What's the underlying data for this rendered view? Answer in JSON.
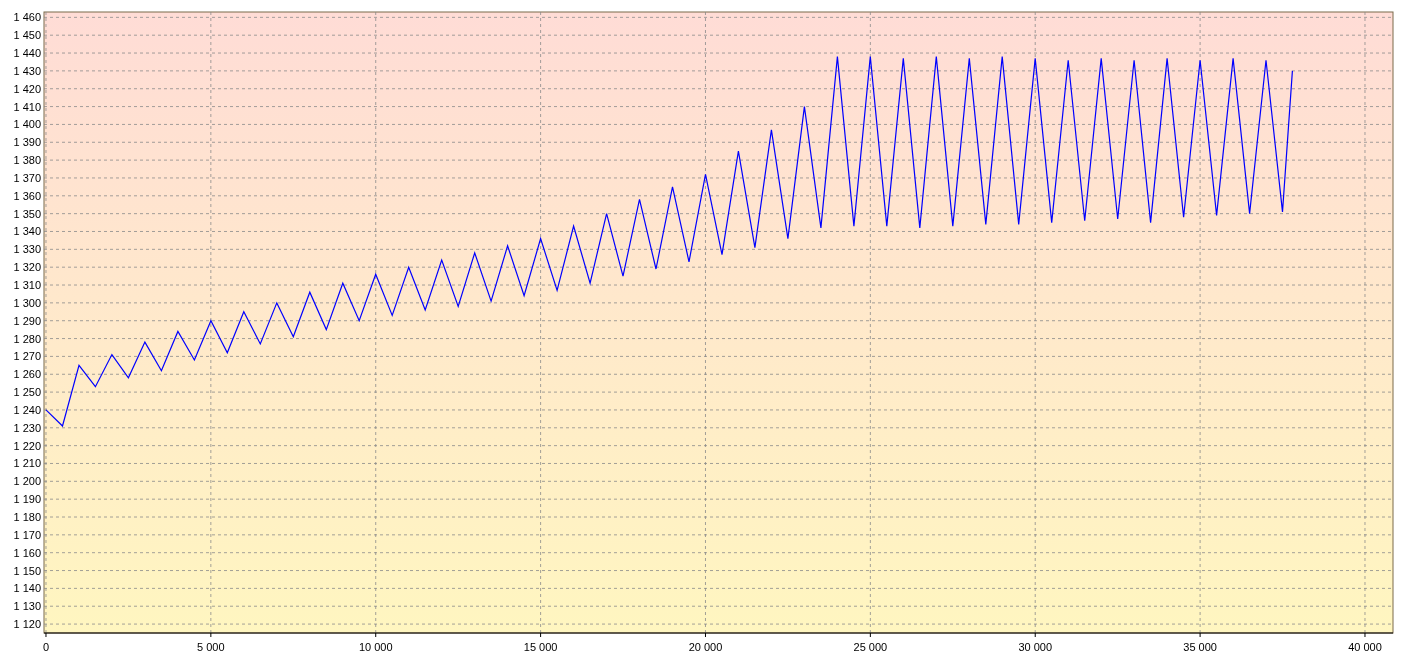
{
  "chart_data": {
    "type": "line",
    "grid": true,
    "xlim": [
      -60,
      40850
    ],
    "ylim": [
      1115,
      1463
    ],
    "xticks": [
      {
        "value": 0,
        "label": "0"
      },
      {
        "value": 5000,
        "label": "5 000"
      },
      {
        "value": 10000,
        "label": "10 000"
      },
      {
        "value": 15000,
        "label": "15 000"
      },
      {
        "value": 20000,
        "label": "20 000"
      },
      {
        "value": 25000,
        "label": "25 000"
      },
      {
        "value": 30000,
        "label": "30 000"
      },
      {
        "value": 35000,
        "label": "35 000"
      },
      {
        "value": 40000,
        "label": "40 000"
      }
    ],
    "yticks": [
      {
        "value": 1120,
        "label": "1 120"
      },
      {
        "value": 1130,
        "label": "1 130"
      },
      {
        "value": 1140,
        "label": "1 140"
      },
      {
        "value": 1150,
        "label": "1 150"
      },
      {
        "value": 1160,
        "label": "1 160"
      },
      {
        "value": 1170,
        "label": "1 170"
      },
      {
        "value": 1180,
        "label": "1 180"
      },
      {
        "value": 1190,
        "label": "1 190"
      },
      {
        "value": 1200,
        "label": "1 200"
      },
      {
        "value": 1210,
        "label": "1 210"
      },
      {
        "value": 1220,
        "label": "1 220"
      },
      {
        "value": 1230,
        "label": "1 230"
      },
      {
        "value": 1240,
        "label": "1 240"
      },
      {
        "value": 1250,
        "label": "1 250"
      },
      {
        "value": 1260,
        "label": "1 260"
      },
      {
        "value": 1270,
        "label": "1 270"
      },
      {
        "value": 1280,
        "label": "1 280"
      },
      {
        "value": 1290,
        "label": "1 290"
      },
      {
        "value": 1300,
        "label": "1 300"
      },
      {
        "value": 1310,
        "label": "1 310"
      },
      {
        "value": 1320,
        "label": "1 320"
      },
      {
        "value": 1330,
        "label": "1 330"
      },
      {
        "value": 1340,
        "label": "1 340"
      },
      {
        "value": 1350,
        "label": "1 350"
      },
      {
        "value": 1360,
        "label": "1 360"
      },
      {
        "value": 1370,
        "label": "1 370"
      },
      {
        "value": 1380,
        "label": "1 380"
      },
      {
        "value": 1390,
        "label": "1 390"
      },
      {
        "value": 1400,
        "label": "1 400"
      },
      {
        "value": 1410,
        "label": "1 410"
      },
      {
        "value": 1420,
        "label": "1 420"
      },
      {
        "value": 1430,
        "label": "1 430"
      },
      {
        "value": 1440,
        "label": "1 440"
      },
      {
        "value": 1450,
        "label": "1 450"
      },
      {
        "value": 1460,
        "label": "1 460"
      }
    ],
    "x": [
      0,
      500,
      1000,
      1500,
      2000,
      2500,
      3000,
      3500,
      4000,
      4500,
      5000,
      5500,
      6000,
      6500,
      7000,
      7500,
      8000,
      8500,
      9000,
      9500,
      10000,
      10500,
      11000,
      11500,
      12000,
      12500,
      13000,
      13500,
      14000,
      14500,
      15000,
      15500,
      16000,
      16500,
      17000,
      17500,
      18000,
      18500,
      19000,
      19500,
      20000,
      20500,
      21000,
      21500,
      22000,
      22500,
      23000,
      23500,
      24000,
      24500,
      25000,
      25500,
      26000,
      26500,
      27000,
      27500,
      28000,
      28500,
      29000,
      29500,
      30000,
      30500,
      31000,
      31500,
      32000,
      32500,
      33000,
      33500,
      34000,
      34500,
      35000,
      35500,
      36000,
      36500,
      37000,
      37500,
      37800
    ],
    "series": [
      {
        "color": "#0000ff",
        "values": [
          1240,
          1231,
          1265,
          1253,
          1271,
          1258,
          1278,
          1262,
          1284,
          1268,
          1290,
          1272,
          1295,
          1277,
          1300,
          1281,
          1306,
          1285,
          1311,
          1290,
          1316,
          1293,
          1320,
          1296,
          1324,
          1298,
          1328,
          1301,
          1332,
          1304,
          1336,
          1307,
          1343,
          1311,
          1350,
          1315,
          1358,
          1319,
          1365,
          1323,
          1372,
          1327,
          1385,
          1331,
          1397,
          1336,
          1410,
          1342,
          1438,
          1343,
          1438,
          1343,
          1437,
          1342,
          1438,
          1343,
          1437,
          1344,
          1438,
          1344,
          1437,
          1345,
          1436,
          1346,
          1437,
          1347,
          1436,
          1345,
          1437,
          1348,
          1436,
          1349,
          1437,
          1350,
          1436,
          1351,
          1430
        ]
      }
    ]
  }
}
